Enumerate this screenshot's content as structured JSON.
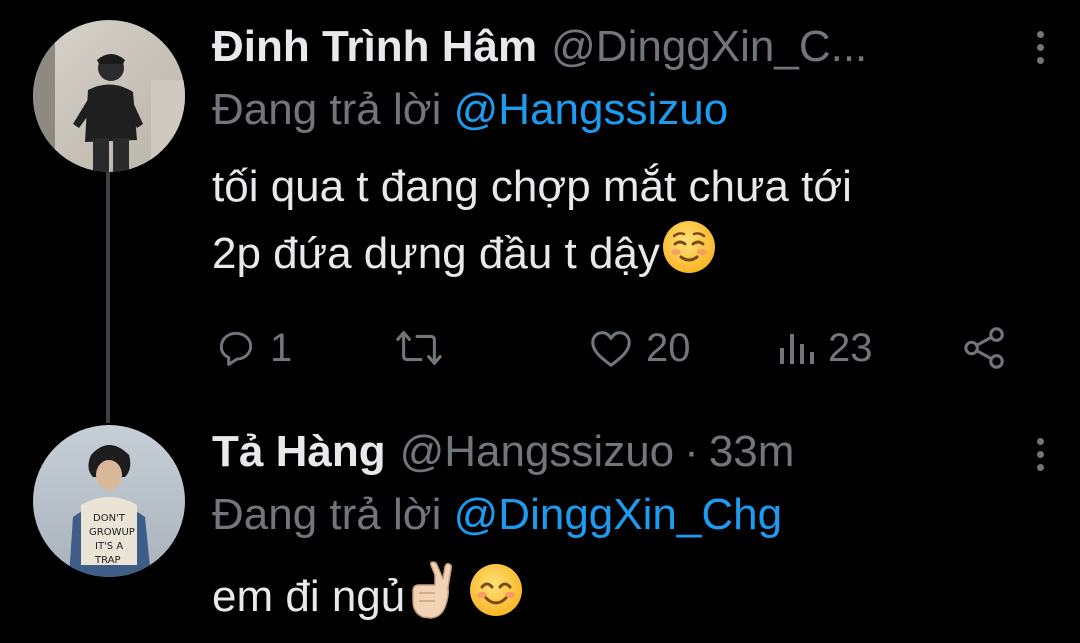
{
  "tweets": [
    {
      "name": "Đinh Trình Hâm",
      "handle": "@DinggXin_C...",
      "replying_prefix": "Đang trả lời",
      "replying_to": "@Hangssizuo",
      "text_line1": "tối qua t đang chợp mắt chưa tới",
      "text_line2": "2p đứa dựng đầu t dậy",
      "emoji": "relieved-face-emoji",
      "actions": {
        "reply_count": "1",
        "retweet_count": "",
        "like_count": "20",
        "view_count": "23"
      }
    },
    {
      "name": "Tả Hàng",
      "handle": "@Hangssizuo",
      "separator": "·",
      "time": "33m",
      "replying_prefix": "Đang trả lời",
      "replying_to": "@DinggXin_Chg",
      "text": "em đi ngủ",
      "emojis": [
        "crossed-fingers-emoji",
        "smiling-face-emoji"
      ]
    }
  ],
  "colors": {
    "background": "#000000",
    "text": "#e7e9ea",
    "secondary": "#71767b",
    "mention": "#1d9bf0",
    "thread_line": "#3e4144"
  }
}
